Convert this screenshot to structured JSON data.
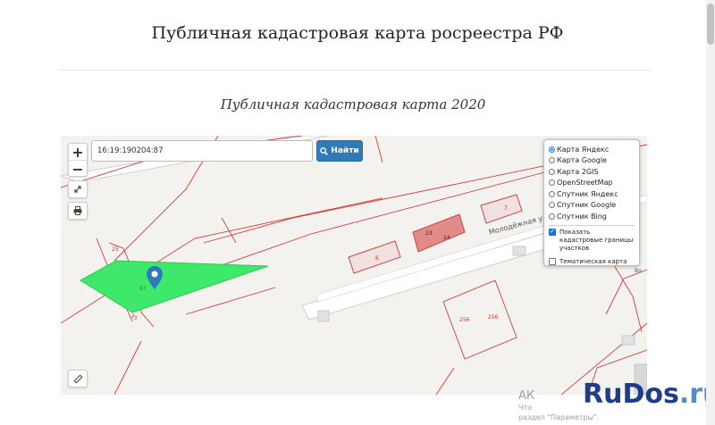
{
  "page": {
    "title": "Публичная кадастровая карта росреестра РФ",
    "subtitle": "Публичная кадастровая карта 2020"
  },
  "map": {
    "zoom_in": "+",
    "zoom_out": "−",
    "search_value": "16:19:190204:87",
    "search_button": "Найти",
    "layers": [
      {
        "label": "Карта Яндекс",
        "selected": true
      },
      {
        "label": "Карта Google",
        "selected": false
      },
      {
        "label": "Карта 2GIS",
        "selected": false
      },
      {
        "label": "OpenStreetMap",
        "selected": false
      },
      {
        "label": "Спутник Яндекс",
        "selected": false
      },
      {
        "label": "Спутник Google",
        "selected": false
      },
      {
        "label": "Спутник Bing",
        "selected": false
      }
    ],
    "cadastral_checkbox": {
      "label": "Показать кадастровые границы участков",
      "checked": true
    },
    "thematic_checkbox": {
      "label": "Тематическая карта",
      "checked": false
    },
    "street": "Молодёжная ул.",
    "labels": {
      "l25": "25",
      "l6": "6",
      "l23": "23",
      "l24": "24",
      "l7": "7",
      "l256a": "256",
      "l256b": "256",
      "l35": "35",
      "l87": "87",
      "vo": "Во"
    },
    "colors": {
      "parcel_fill": "#3de86a",
      "boundary": "#d63b3b",
      "accent": "#2f7ab8"
    }
  },
  "watermark": {
    "prefix": "RuDos",
    "suffix": ".ru"
  },
  "footer_fragments": {
    "a": "АК",
    "b": "Что",
    "c": "раздел \"Параметры\"."
  }
}
